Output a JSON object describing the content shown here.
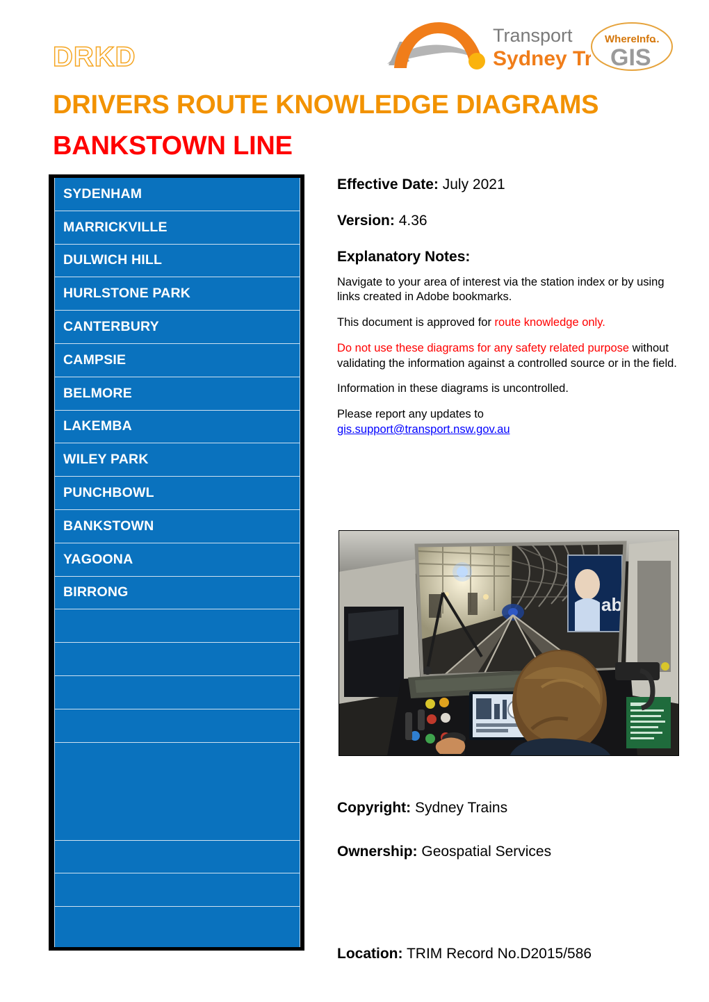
{
  "header": {
    "drkd_tag": "DRKD",
    "main_title": "DRIVERS ROUTE KNOWLEDGE DIAGRAMS",
    "line_title": "BANKSTOWN LINE",
    "logos": {
      "transport": {
        "line1": "Transport",
        "line2": "Sydney Trains"
      },
      "gis": {
        "top": "WhereInfo",
        "dots": "...",
        "main": "GIS"
      }
    }
  },
  "station_index": {
    "stations": [
      "SYDENHAM",
      "MARRICKVILLE",
      "DULWICH HILL",
      "HURLSTONE PARK",
      "CANTERBURY",
      "CAMPSIE",
      "BELMORE",
      "LAKEMBA",
      "WILEY PARK",
      "PUNCHBOWL",
      "BANKSTOWN",
      "YAGOONA",
      "BIRRONG"
    ],
    "empty_rows": 7,
    "panel_color": "#0A72BE",
    "border_color": "#000000",
    "divider_color": "#CFE2F1",
    "text_color": "#FFFFFF"
  },
  "details": {
    "effective_date_label": "Effective Date:",
    "effective_date_value": "July 2021",
    "version_label": "Version:",
    "version_value": "4.36",
    "notes_heading": "Explanatory Notes:",
    "note_navigate": "Navigate to your area of interest via the station index or by using links created in Adobe bookmarks.",
    "note_approved_prefix": "This document is approved for ",
    "note_approved_red": "route knowledge only.",
    "note_warning_red1": "Do not use these diagrams for any safety related purpose",
    "note_warning_rest": " without validating the information against a controlled source or in the field.",
    "note_uncontrolled": "Information in these diagrams is uncontrolled.",
    "note_report": "Please report any updates to",
    "support_email": "gis.support@transport.nsw.gov.au"
  },
  "photo": {
    "caption": "train-cab-driver-view-tunnel"
  },
  "footer": {
    "copyright_label": "Copyright:",
    "copyright_value": "Sydney Trains",
    "ownership_label": "Ownership:",
    "ownership_value": "Geospatial Services",
    "location_label": "Location:",
    "location_value": "TRIM Record No.D2015/586"
  },
  "colors": {
    "orange": "#F29200",
    "red": "#FF0000",
    "blue_panel": "#0A72BE",
    "link_blue": "#0000FF"
  }
}
